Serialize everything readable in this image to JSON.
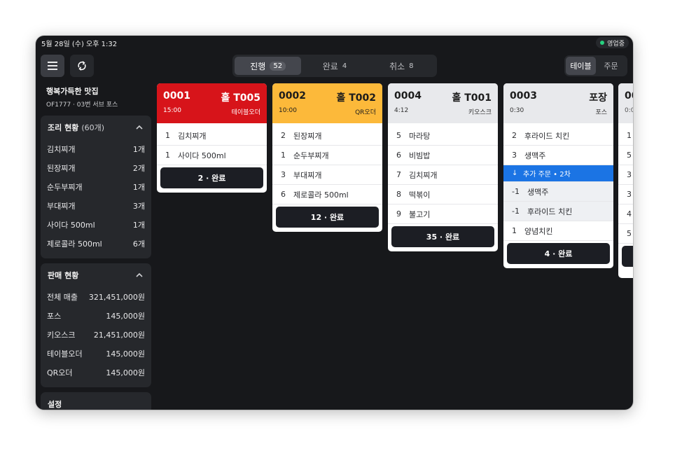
{
  "status_bar": {
    "datetime": "5월 28일 (수) 오후 1:32",
    "status": "영업중",
    "status_color": "#27d17f"
  },
  "header": {
    "tabs": [
      {
        "label": "진행",
        "count": "52",
        "active": true
      },
      {
        "label": "완료",
        "count": "4",
        "active": false
      },
      {
        "label": "취소",
        "count": "8",
        "active": false
      }
    ],
    "view_toggle": [
      {
        "label": "테이블",
        "active": true
      },
      {
        "label": "주문",
        "active": false
      }
    ],
    "menu_icon": "hamburger-icon",
    "sync_icon": "sync-icon"
  },
  "sidebar": {
    "store_name": "행복가득한 맛집",
    "store_sub": "OF1777 · 03번 서브 포스",
    "cooking": {
      "title": "조리 현황",
      "total": "(60개)",
      "items": [
        {
          "name": "김치찌개",
          "count": "1개"
        },
        {
          "name": "된장찌개",
          "count": "2개"
        },
        {
          "name": "순두부찌개",
          "count": "1개"
        },
        {
          "name": "부대찌개",
          "count": "3개"
        },
        {
          "name": "사이다 500ml",
          "count": "1개"
        },
        {
          "name": "제로콜라 500ml",
          "count": "6개"
        }
      ]
    },
    "sales": {
      "title": "판매 현황",
      "items": [
        {
          "name": "전체 매출",
          "amount": "321,451,000원"
        },
        {
          "name": "포스",
          "amount": "145,000원"
        },
        {
          "name": "키오스크",
          "amount": "21,451,000원"
        },
        {
          "name": "테이블오더",
          "amount": "145,000원"
        },
        {
          "name": "QR오더",
          "amount": "145,000원"
        }
      ]
    },
    "settings_title": "설정"
  },
  "orders": [
    {
      "num": "0001",
      "table": "홀 T005",
      "time": "15:00",
      "source": "테이블오더",
      "color": "#d7141a",
      "items": [
        {
          "qty": "1",
          "name": "김치찌개"
        },
        {
          "qty": "1",
          "name": "사이다 500ml"
        }
      ],
      "done": "2 · 완료"
    },
    {
      "num": "0002",
      "table": "홀 T002",
      "time": "10:00",
      "source": "QR오더",
      "color": "#fcb93a",
      "items": [
        {
          "qty": "2",
          "name": "된장찌개"
        },
        {
          "qty": "1",
          "name": "순두부찌개"
        },
        {
          "qty": "3",
          "name": "부대찌개"
        },
        {
          "qty": "6",
          "name": "제로콜라 500ml"
        }
      ],
      "done": "12 · 완료"
    },
    {
      "num": "0004",
      "table": "홀 T001",
      "time": "4:12",
      "source": "키오스크",
      "color": "#e8e9ec",
      "items": [
        {
          "qty": "5",
          "name": "마라탕"
        },
        {
          "qty": "6",
          "name": "비빔밥"
        },
        {
          "qty": "7",
          "name": "김치찌개"
        },
        {
          "qty": "8",
          "name": "떡볶이"
        },
        {
          "qty": "9",
          "name": "불고기"
        }
      ],
      "done": "35 · 완료"
    },
    {
      "num": "0003",
      "table": "포장",
      "time": "0:30",
      "source": "포스",
      "color": "#e8e9ec",
      "items": [
        {
          "qty": "2",
          "name": "후라이드 치킨"
        },
        {
          "qty": "3",
          "name": "생맥주"
        }
      ],
      "added_banner": "추가 주문 • 2차",
      "added_items": [
        {
          "qty": "-1",
          "name": "생맥주"
        },
        {
          "qty": "-1",
          "name": "후라이드 치킨"
        },
        {
          "qty": "1",
          "name": "양념치킨"
        }
      ],
      "done": "4 · 완료"
    }
  ],
  "partial_card": {
    "num": "00",
    "time": "0:0",
    "qtys": [
      "1",
      "5",
      "3",
      "3",
      "4",
      "5"
    ]
  }
}
